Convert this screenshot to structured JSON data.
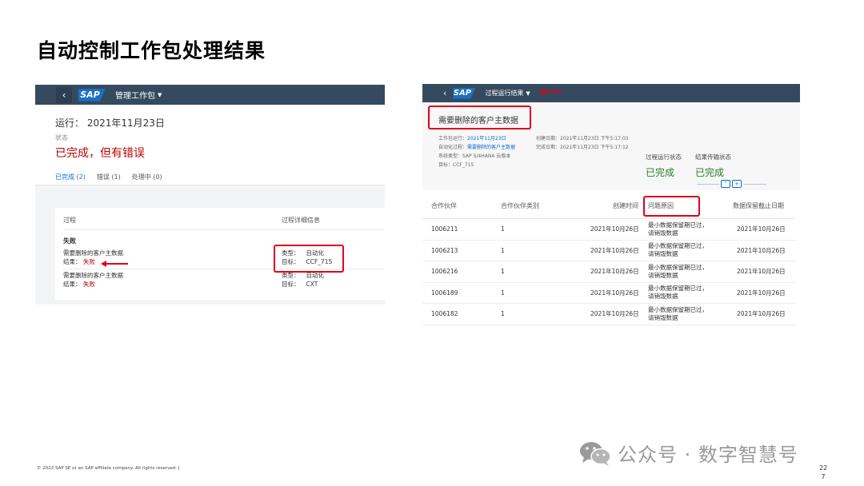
{
  "slide": {
    "title": "自动控制工作包处理结果",
    "copyright": "© 2022 SAP SE or an SAP affiliate company. All rights reserved.  ǀ",
    "page_number_top": "22",
    "page_number_bottom": "7",
    "watermark": "公众号 · 数字智慧号"
  },
  "left": {
    "shell": {
      "back": "‹",
      "logo": "SAP",
      "title": "管理工作包"
    },
    "run": "运行：  2021年11月23日",
    "status_label": "状态",
    "status": "已完成，但有错误",
    "tabs": [
      "已完成 (2)",
      "错误 (1)",
      "处理中 (0)"
    ],
    "table": {
      "col_process": "过程",
      "col_detail": "过程详细信息",
      "section": "失败",
      "rows": [
        {
          "name": "需要删除的客户主数据",
          "result_label": "结果：",
          "result": "失败",
          "type_label": "类型：",
          "type": "自动化",
          "target_label": "目标：",
          "target": "CCF_715"
        },
        {
          "name": "需要删除的客户主数据",
          "result_label": "结果：",
          "result": "失败",
          "type_label": "类型：",
          "type": "自动化",
          "target_label": "目标：",
          "target": "CXT"
        }
      ]
    }
  },
  "right": {
    "shell": {
      "back": "‹",
      "logo": "SAP",
      "title": "过程运行结果"
    },
    "object_title": "需要删除的客户主数据",
    "meta": {
      "run_label": "工作包运行：",
      "run": "2021年11月23日",
      "process_label": "自动化过程：",
      "process": "需要删除的客户主数据",
      "system_label": "系统类型：",
      "system": "SAP S/4HANA 云版本",
      "target_label": "目标：",
      "target": "CCF_715",
      "created_label": "创建日期：",
      "created": "2021年11月23日 下午5:17:03",
      "finished_label": "完成日期：",
      "finished": "2021年11月23日 下午5:17:12"
    },
    "kpis": [
      {
        "label": "过程运行状态",
        "value": "已完成"
      },
      {
        "label": "结果传输状态",
        "value": "已完成"
      }
    ],
    "collapse_buttons": [
      "⌃",
      "⌖"
    ],
    "columns": [
      "合作伙伴",
      "合作伙伴类别",
      "创建时间",
      "问题原因",
      "数据保留截止日期"
    ],
    "rows": [
      {
        "partner": "1006211",
        "category": "1",
        "created": "2021年10月26日",
        "reason": "最小数据保留期已过，请销毁数据",
        "retention": "2021年10月26日"
      },
      {
        "partner": "1006213",
        "category": "1",
        "created": "2021年10月26日",
        "reason": "最小数据保留期已过，请销毁数据",
        "retention": "2021年10月26日"
      },
      {
        "partner": "1006216",
        "category": "1",
        "created": "2021年10月26日",
        "reason": "最小数据保留期已过，请销毁数据",
        "retention": "2021年10月26日"
      },
      {
        "partner": "1006189",
        "category": "1",
        "created": "2021年10月26日",
        "reason": "最小数据保留期已过，请销毁数据",
        "retention": "2021年10月26日"
      },
      {
        "partner": "1006182",
        "category": "1",
        "created": "2021年10月26日",
        "reason": "最小数据保留期已过，请销毁数据",
        "retention": "2021年10月26日"
      }
    ]
  },
  "colors": {
    "shell": "#354a5f",
    "error": "#bb0000",
    "success": "#2b7c2b",
    "link": "#0a6ed1",
    "annotation": "#e0001b"
  }
}
